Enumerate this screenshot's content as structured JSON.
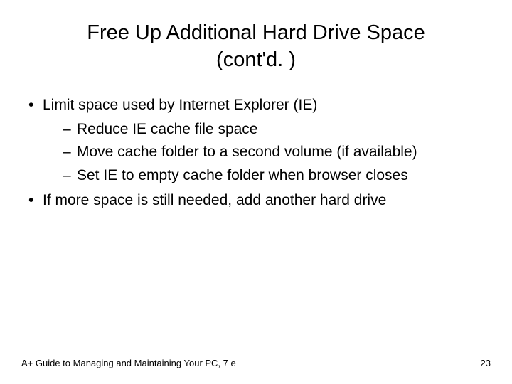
{
  "title_line1": "Free Up Additional Hard Drive Space",
  "title_line2": "(cont'd. )",
  "bullets": [
    {
      "text": "Limit space used by Internet Explorer (IE)",
      "sub": [
        "Reduce IE cache file space",
        "Move cache folder to a second volume (if available)",
        "Set IE to empty cache folder when browser closes"
      ]
    },
    {
      "text": "If more space is still needed, add another hard drive",
      "sub": []
    }
  ],
  "footer_left": "A+ Guide to Managing and Maintaining Your PC, 7 e",
  "footer_right": "23"
}
